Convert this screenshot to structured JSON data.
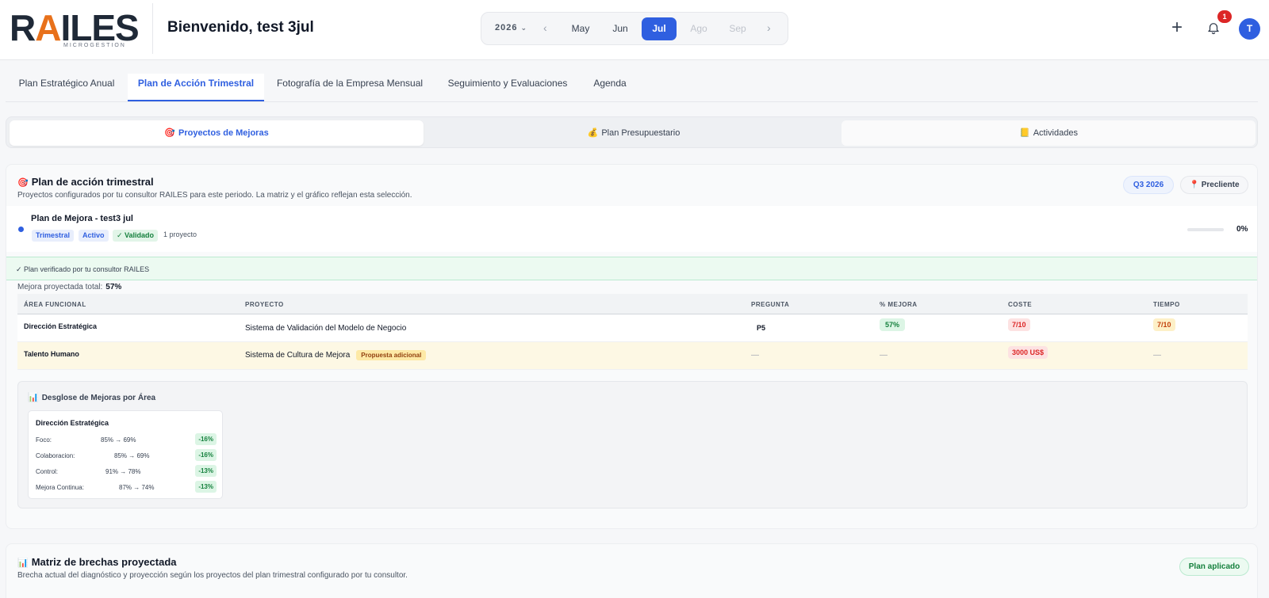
{
  "header": {
    "logo_main": "RAILES",
    "logo_sub": "MICROGESTION",
    "welcome": "Bienvenido, test 3jul",
    "year": "2026",
    "months": [
      "May",
      "Jun",
      "Jul",
      "Ago",
      "Sep"
    ],
    "active_month": "Jul",
    "notifications_count": "1",
    "avatar_initial": "T"
  },
  "tabs": [
    "Plan Estratégico Anual",
    "Plan de Acción Trimestral",
    "Fotografía de la Empresa Mensual",
    "Seguimiento y Evaluaciones",
    "Agenda"
  ],
  "subtabs": [
    "Proyectos de Mejoras",
    "Plan Presupuestario",
    "Actividades"
  ],
  "plan_section": {
    "title": "Plan de acción trimestral",
    "subtitle": "Proyectos configurados por tu consultor RAILES para este periodo. La matriz y el gráfico reflejan esta selección.",
    "quarter_pill": "Q3 2026",
    "status_pill": "Precliente",
    "plan_name": "Plan de Mejora - test3 jul",
    "tags": [
      "Trimestral",
      "Activo",
      "✓ Validado"
    ],
    "project_count": "1 proyecto",
    "progress_percent": "0%",
    "progress_value": 0,
    "verified_text": "✓ Plan verificado por tu consultor RAILES",
    "mejora_label": "Mejora proyectada total:",
    "mejora_value": "57%"
  },
  "table": {
    "headers": [
      "ÁREA FUNCIONAL",
      "PROYECTO",
      "PREGUNTA",
      "% MEJORA",
      "COSTE",
      "TIEMPO"
    ],
    "rows": [
      {
        "area": "Dirección Estratégica",
        "proyecto": "Sistema de Validación del Modelo de Negocio",
        "pregunta": "P5",
        "mejora": "57%",
        "coste": "7/10",
        "tiempo": "7/10"
      },
      {
        "area": "Talento Humano",
        "proyecto": "Sistema de Cultura de Mejora",
        "propuesta": "Propuesta adicional",
        "pregunta": "—",
        "mejora": "—",
        "coste": "3000 US$",
        "tiempo": "—"
      }
    ]
  },
  "breakdown": {
    "title": "Desglose de Mejoras por Área",
    "card_title": "Dirección Estratégica",
    "rows": [
      {
        "label": "Foco:",
        "value": "85% → 69%",
        "delta": "-16%"
      },
      {
        "label": "Colaboracion:",
        "value": "85% → 69%",
        "delta": "-16%"
      },
      {
        "label": "Control:",
        "value": "91% → 78%",
        "delta": "-13%"
      },
      {
        "label": "Mejora Continua:",
        "value": "87% → 74%",
        "delta": "-13%"
      }
    ]
  },
  "matrix_section": {
    "title": "Matriz de brechas proyectada",
    "subtitle": "Brecha actual del diagnóstico y proyección según los proyectos del plan trimestral configurado por tu consultor.",
    "pill": "Plan aplicado"
  },
  "colors": {
    "accent": "#2f5fe0",
    "logo_accent": "#e8711b",
    "success": "#15803d",
    "danger": "#dc2626"
  },
  "icons": [
    "chevron-down-icon",
    "chevron-left-icon",
    "chevron-right-icon",
    "plus-icon",
    "bell-icon",
    "target-icon",
    "money-bag-icon",
    "notebook-icon",
    "bar-chart-icon",
    "pin-icon"
  ]
}
